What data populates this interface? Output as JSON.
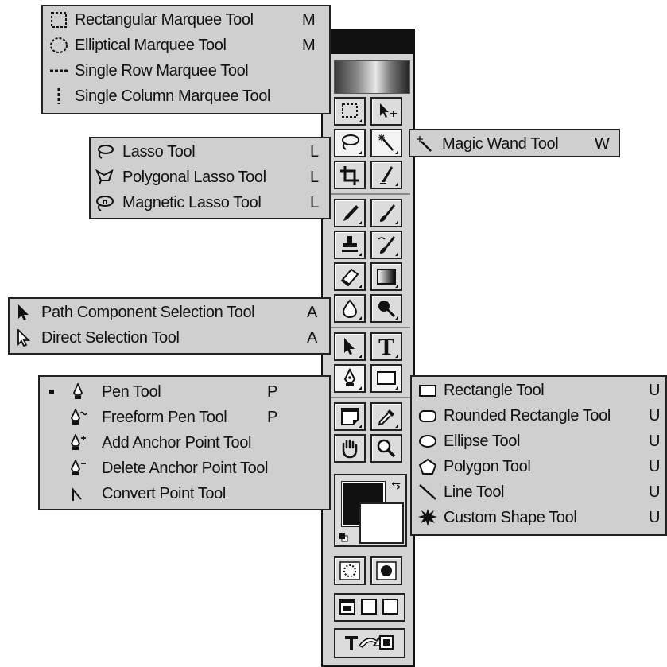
{
  "marquee_menu": {
    "items": [
      {
        "label": "Rectangular Marquee Tool",
        "key": "M"
      },
      {
        "label": "Elliptical Marquee Tool",
        "key": "M"
      },
      {
        "label": "Single Row Marquee Tool",
        "key": ""
      },
      {
        "label": "Single Column Marquee Tool",
        "key": ""
      }
    ]
  },
  "magic_wand_menu": {
    "items": [
      {
        "label": "Magic Wand Tool",
        "key": "W"
      }
    ]
  },
  "lasso_menu": {
    "items": [
      {
        "label": "Lasso Tool",
        "key": "L"
      },
      {
        "label": "Polygonal Lasso Tool",
        "key": "L"
      },
      {
        "label": "Magnetic Lasso Tool",
        "key": "L"
      }
    ]
  },
  "selection_menu": {
    "items": [
      {
        "label": "Path Component Selection Tool",
        "key": "A"
      },
      {
        "label": "Direct Selection Tool",
        "key": "A"
      }
    ]
  },
  "pen_menu": {
    "items": [
      {
        "label": "Pen Tool",
        "key": "P"
      },
      {
        "label": "Freeform Pen Tool",
        "key": "P"
      },
      {
        "label": "Add Anchor Point Tool",
        "key": ""
      },
      {
        "label": "Delete Anchor Point Tool",
        "key": ""
      },
      {
        "label": "Convert Point Tool",
        "key": ""
      }
    ]
  },
  "shape_menu": {
    "items": [
      {
        "label": "Rectangle Tool",
        "key": "U"
      },
      {
        "label": "Rounded Rectangle Tool",
        "key": "U"
      },
      {
        "label": "Ellipse Tool",
        "key": "U"
      },
      {
        "label": "Polygon Tool",
        "key": "U"
      },
      {
        "label": "Line Tool",
        "key": "U"
      },
      {
        "label": "Custom Shape Tool",
        "key": "U"
      }
    ]
  },
  "toolbox": {
    "type_tool_glyph": "T",
    "colors": {
      "foreground": "#111111",
      "background": "#ffffff"
    }
  }
}
